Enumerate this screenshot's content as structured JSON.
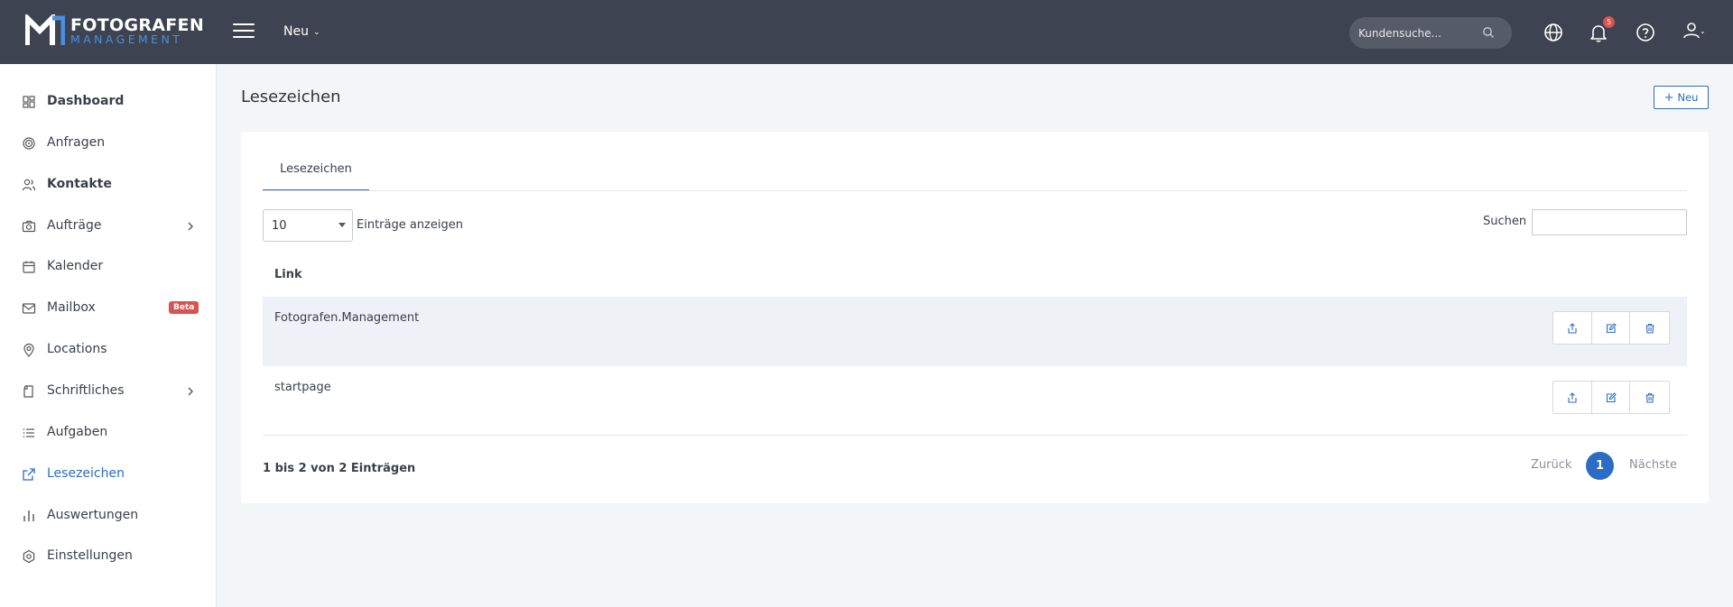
{
  "brand": {
    "line1": "FOTOGRAFEN",
    "line2": "MANAGEMENT",
    "accent": "#4a8fe0"
  },
  "topbar": {
    "menu_label": "Neu",
    "search_placeholder": "Kundensuche...",
    "notification_count": "5",
    "icons": [
      "menu-icon",
      "search-icon",
      "globe-icon",
      "bell-icon",
      "help-icon",
      "user-icon"
    ]
  },
  "sidebar": {
    "items": [
      {
        "label": "Dashboard",
        "icon": "dashboard-icon"
      },
      {
        "label": "Anfragen",
        "icon": "target-icon"
      },
      {
        "label": "Kontakte",
        "icon": "users-icon"
      },
      {
        "label": "Aufträge",
        "icon": "camera-icon"
      },
      {
        "label": "Kalender",
        "icon": "calendar-icon"
      },
      {
        "label": "Mailbox",
        "icon": "mail-icon",
        "badge": "Beta"
      },
      {
        "label": "Locations",
        "icon": "location-pin-icon"
      },
      {
        "label": "Schriftliches",
        "icon": "document-icon"
      },
      {
        "label": "Aufgaben",
        "icon": "list-icon"
      },
      {
        "label": "Lesezeichen",
        "icon": "external-link-icon",
        "active": true
      },
      {
        "label": "Auswertungen",
        "icon": "bar-chart-icon"
      },
      {
        "label": "Einstellungen",
        "icon": "settings-icon"
      }
    ]
  },
  "main": {
    "title": "Lesezeichen",
    "new_button": "Neu",
    "tab": "Lesezeichen",
    "length_value": "10",
    "length_label": "Einträge anzeigen",
    "search_label": "Suchen",
    "column_header": "Link",
    "rows": [
      {
        "link": "Fotografen.Management"
      },
      {
        "link": "startpage"
      }
    ],
    "info": "1 bis 2 von 2 Einträgen",
    "pagination": {
      "prev": "Zurück",
      "current": "1",
      "next": "Nächste"
    }
  },
  "colors": {
    "topbar": "#3d4350",
    "primary": "#2b6cc4",
    "badge": "#d9534f"
  }
}
